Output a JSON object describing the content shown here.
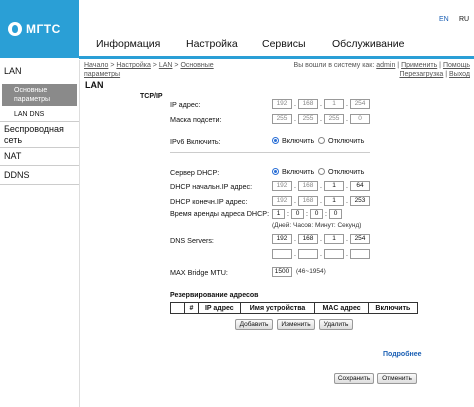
{
  "brand": {
    "name": "МГТС",
    "color": "#2a9fd6"
  },
  "languages": {
    "en": "EN",
    "ru": "RU"
  },
  "nav": [
    "Информация",
    "Настройка",
    "Сервисы",
    "Обслуживание"
  ],
  "sidebar": {
    "lan": "LAN",
    "lan_basic": "Основные параметры",
    "lan_dns": "LAN DNS",
    "wireless": "Беспроводная сеть",
    "nat": "NAT",
    "ddns": "DDNS"
  },
  "breadcrumb": {
    "home": "Начало",
    "settings": "Настройка",
    "lan": "LAN",
    "basic": "Основные",
    "line2": "параметры",
    "sep": " > "
  },
  "session": {
    "prefix": "Вы вошли в систему как: ",
    "user": "admin",
    "apply": "Применить",
    "help": "Помощь",
    "reboot": "Перезагрузка",
    "logout": "Выход",
    "sep": " | "
  },
  "page": {
    "title": "LAN",
    "section": "TCP/IP"
  },
  "form": {
    "ip_label": "IP адрес:",
    "ip": [
      "192",
      "168",
      "1",
      "254"
    ],
    "mask_label": "Маска подсети:",
    "mask": [
      "255",
      "255",
      "255",
      "0"
    ],
    "ipv6_label": "IPv6 Включить:",
    "on": "Включить",
    "off": "Отключить",
    "dhcp_label": "Сервер DHCP:",
    "dhcp_start_label": "DHCP начальн.IP адрес:",
    "dhcp_start": [
      "192",
      "168",
      "1",
      "64"
    ],
    "dhcp_end_label": "DHCP конечн.IP адрес:",
    "dhcp_end": [
      "192",
      "168",
      "1",
      "253"
    ],
    "lease_label": "Время аренды адреса DHCP:",
    "lease": [
      "1",
      "0",
      "0",
      "0"
    ],
    "lease_note": "(Дней: Часов: Минут: Секунд)",
    "dns_label": "DNS Servers:",
    "dns1": [
      "192",
      "168",
      "1",
      "254"
    ],
    "mtu_label": "MAX Bridge MTU:",
    "mtu": "1500",
    "mtu_range": "(46~1954)"
  },
  "reservation": {
    "title": "Резервирование адресов",
    "columns": [
      "",
      "#",
      "IP адрес",
      "Имя устройства",
      "MAC адрес",
      "Включить"
    ],
    "add": "Добавить",
    "edit": "Изменить",
    "delete": "Удалить"
  },
  "more": "Подробнее",
  "footer": {
    "save": "Сохранить",
    "cancel": "Отменить"
  }
}
